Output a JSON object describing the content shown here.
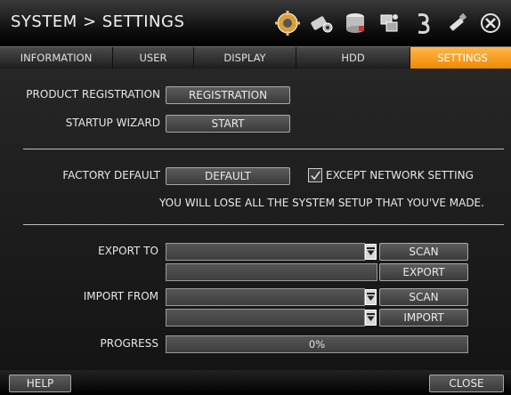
{
  "window": {
    "title": "SYSTEM > SETTINGS"
  },
  "toolbar_icons": [
    "settings-gear-icon",
    "camera-icon",
    "storage-icon",
    "network-icon",
    "event-icon",
    "usb-icon",
    "close-icon"
  ],
  "tabs": [
    {
      "label": "INFORMATION",
      "active": false
    },
    {
      "label": "USER",
      "active": false
    },
    {
      "label": "DISPLAY",
      "active": false
    },
    {
      "label": "HDD",
      "active": false
    },
    {
      "label": "SETTINGS",
      "active": true
    }
  ],
  "registration": {
    "label": "PRODUCT REGISTRATION",
    "button": "REGISTRATION"
  },
  "wizard": {
    "label": "STARTUP WIZARD",
    "button": "START"
  },
  "factory": {
    "label": "FACTORY DEFAULT",
    "button": "DEFAULT",
    "except_label": "EXCEPT NETWORK SETTING",
    "except_checked": true,
    "warning": "YOU WILL LOSE ALL THE SYSTEM SETUP THAT YOU'VE MADE."
  },
  "export": {
    "label": "EXPORT TO",
    "target_value": "",
    "file_value": "",
    "scan_button": "SCAN",
    "action_button": "EXPORT"
  },
  "import": {
    "label": "IMPORT FROM",
    "target_value": "",
    "file_value": "",
    "scan_button": "SCAN",
    "action_button": "IMPORT"
  },
  "progress": {
    "label": "PROGRESS",
    "value": 0,
    "text": "0%"
  },
  "footer": {
    "help_button": "HELP",
    "close_button": "CLOSE"
  },
  "colors": {
    "accent": "#f08a00",
    "background": "#1c1c1c",
    "text": "#e8e8e8"
  }
}
